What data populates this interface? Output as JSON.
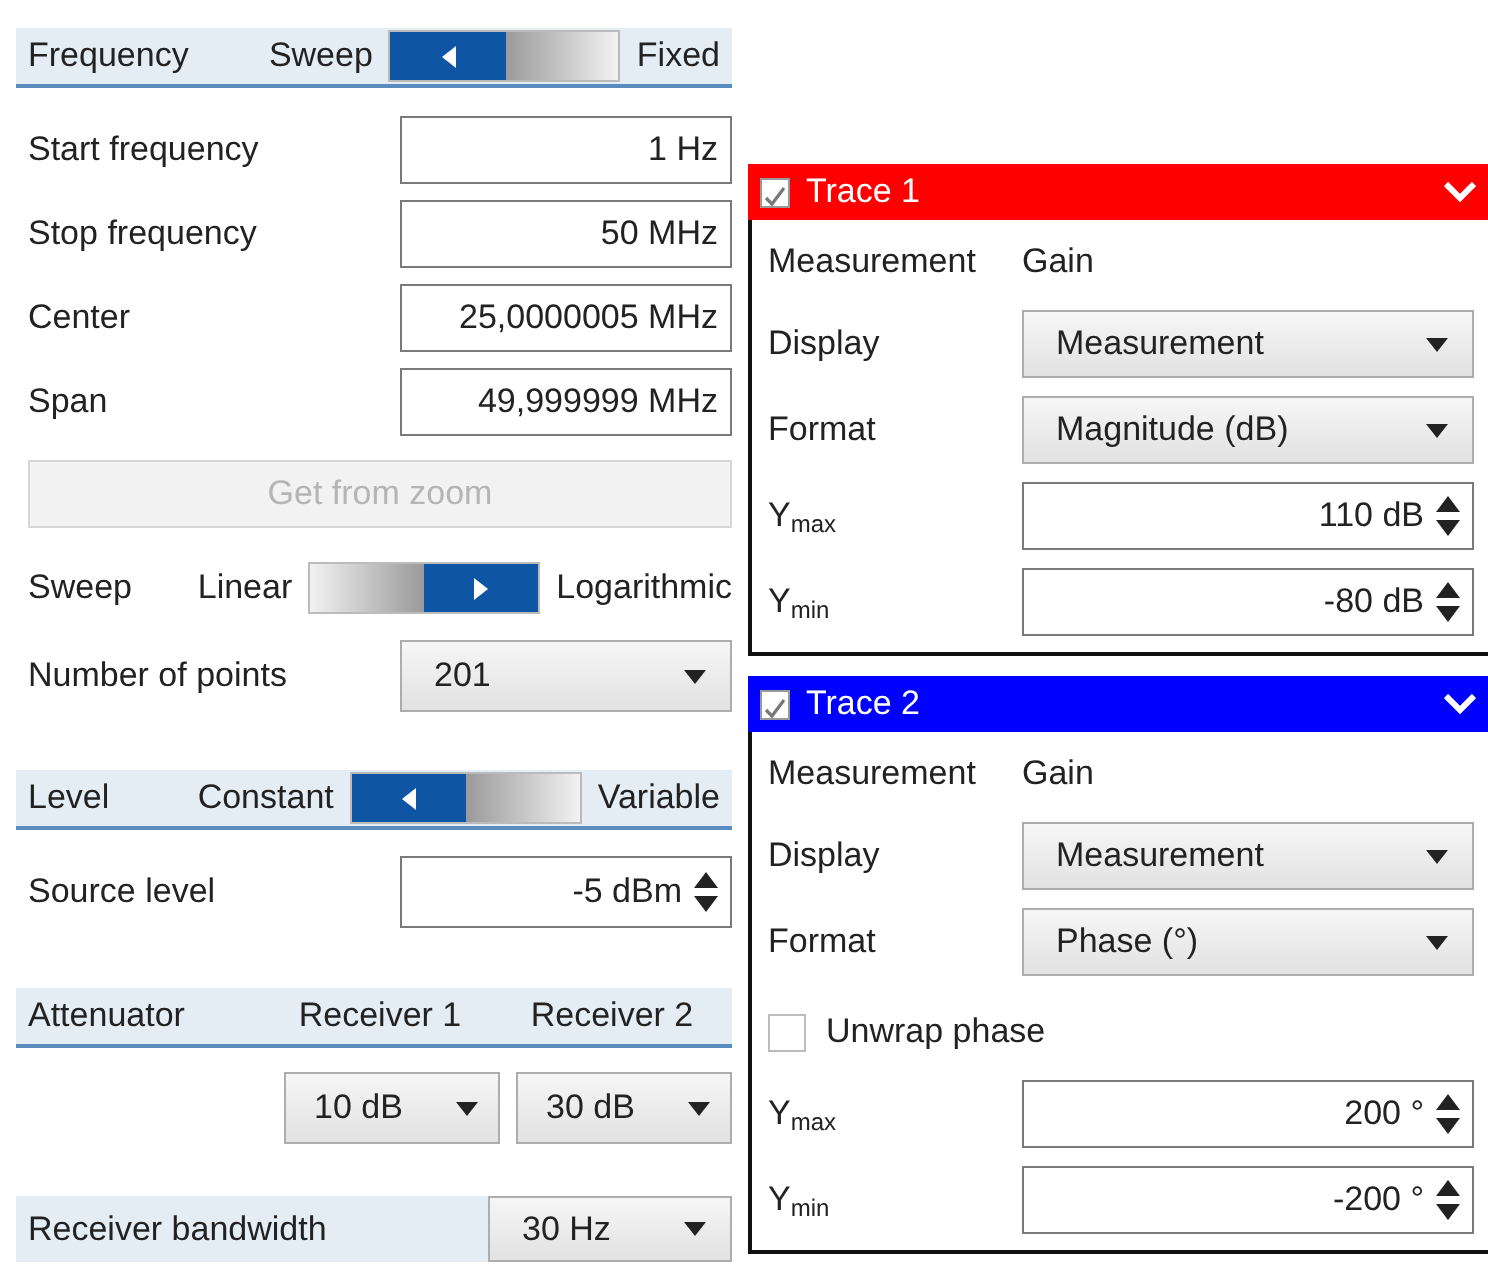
{
  "frequency": {
    "title": "Frequency",
    "toggle": {
      "options": [
        {
          "label": "Sweep",
          "selected": true
        },
        {
          "label": "Fixed",
          "selected": false
        }
      ]
    },
    "fields": [
      {
        "label": "Start frequency",
        "value": "1 Hz"
      },
      {
        "label": "Stop frequency",
        "value": "50 MHz"
      },
      {
        "label": "Center",
        "value": "25,0000005 MHz"
      },
      {
        "label": "Span",
        "value": "49,999999 MHz"
      }
    ],
    "zoom_button": {
      "label": "Get from zoom",
      "disabled": true
    },
    "sweep": {
      "label": "Sweep",
      "toggle": {
        "options": [
          {
            "label": "Linear",
            "selected": false
          },
          {
            "label": "Logarithmic",
            "selected": true
          }
        ]
      }
    },
    "points": {
      "label": "Number of points",
      "value": "201"
    }
  },
  "level": {
    "title": "Level",
    "toggle": {
      "options": [
        {
          "label": "Constant",
          "selected": true
        },
        {
          "label": "Variable",
          "selected": false
        }
      ]
    },
    "source_level": {
      "label": "Source level",
      "value": "-5 dBm"
    }
  },
  "attenuator": {
    "title": "Attenuator",
    "columns": [
      "Receiver 1",
      "Receiver 2"
    ],
    "values": [
      "10 dB",
      "30 dB"
    ]
  },
  "receiver_bandwidth": {
    "label": "Receiver bandwidth",
    "value": "30 Hz"
  },
  "traces": [
    {
      "title": "Trace 1",
      "checked": true,
      "color": "#ff0000",
      "rows": [
        {
          "kind": "text",
          "label": "Measurement",
          "value": "Gain"
        },
        {
          "kind": "dropdown",
          "label": "Display",
          "value": "Measurement"
        },
        {
          "kind": "dropdown",
          "label": "Format",
          "value": "Magnitude (dB)"
        },
        {
          "kind": "spin",
          "label": "Y$_{max}$",
          "value": "110 dB"
        },
        {
          "kind": "spin",
          "label": "Y$_{min}$",
          "value": "-80 dB"
        }
      ]
    },
    {
      "title": "Trace 2",
      "checked": true,
      "color": "#0000ff",
      "rows": [
        {
          "kind": "text",
          "label": "Measurement",
          "value": "Gain"
        },
        {
          "kind": "dropdown",
          "label": "Display",
          "value": "Measurement"
        },
        {
          "kind": "dropdown",
          "label": "Format",
          "value": "Phase (°)"
        },
        {
          "kind": "checkbox",
          "label": "Unwrap phase",
          "checked": false
        },
        {
          "kind": "spin",
          "label": "Y$_{max}$",
          "value": "200 °"
        },
        {
          "kind": "spin",
          "label": "Y$_{min}$",
          "value": "-200 °"
        }
      ]
    }
  ]
}
